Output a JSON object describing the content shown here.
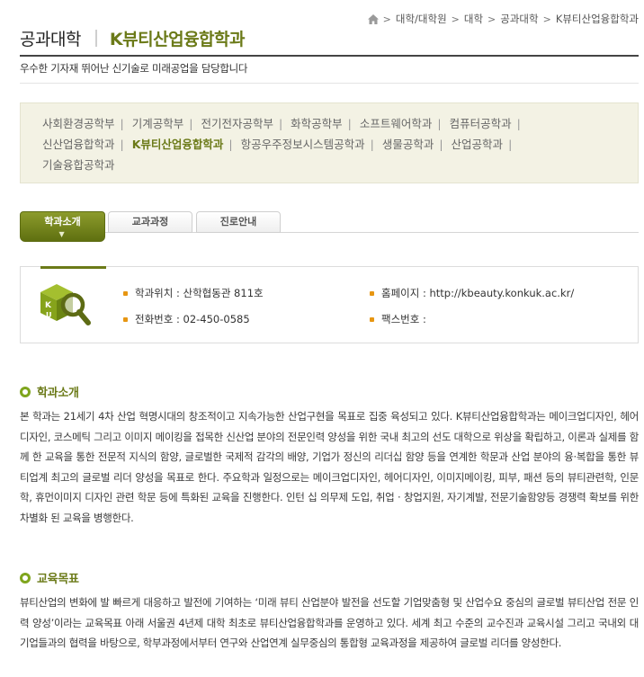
{
  "breadcrumb": {
    "items": [
      "대학/대학원",
      "대학",
      "공과대학",
      "K뷰티산업융합학과"
    ]
  },
  "header": {
    "college": "공과대학",
    "department": "K뷰티산업융합학과",
    "slogan": "우수한 기자재 뛰어난 신기술로 미래공업을 담당합니다"
  },
  "departments": [
    "사회환경공학부",
    "기계공학부",
    "전기전자공학부",
    "화학공학부",
    "소프트웨어학과",
    "컴퓨터공학과",
    "신산업융합학과",
    "K뷰티산업융합학과",
    "항공우주정보시스템공학과",
    "생물공학과",
    "산업공학과",
    "기술융합공학과"
  ],
  "tabs": [
    "학과소개",
    "교과과정",
    "진로안내"
  ],
  "info": {
    "location_label": "학과위치 : 산학협동관 811호",
    "homepage_label": "홈페이지 : http://kbeauty.konkuk.ac.kr/",
    "phone_label": "전화번호 : 02-450-0585",
    "fax_label": "팩스번호 :"
  },
  "sections": {
    "intro_title": "학과소개",
    "intro_text": "본 학과는 21세기 4차 산업 혁명시대의 창조적이고 지속가능한 산업구현을 목표로 집중 육성되고 있다. K뷰티산업융합학과는 메이크업디자인, 헤어디자인, 코스메틱 그리고 이미지 메이킹을 접목한 신산업 분야의 전문인력 양성을 위한 국내 최고의 선도 대학으로 위상을 확립하고, 이론과 실제를 함께 한 교육을 통한 전문적 지식의 함양, 글로벌한 국제적 감각의 배양, 기업가 정신의 리더십 함양 등을 연계한 학문과 산업 분야의 융·복합을 통한 뷰티업계 최고의 글로벌 리더 양성을 목표로 한다. 주요학과 일정으로는 메이크업디자인, 헤어디자인, 이미지메이킹, 피부, 패션 등의 뷰티관련학, 인문학, 휴먼이미지 디자인 관련 학문 등에 특화된 교육을 진행한다. 인턴 십 의무제 도입, 취업 · 창업지원, 자기계발, 전문기술함양등 경쟁력 확보를 위한 차별화 된 교육을 병행한다.",
    "goal_title": "교육목표",
    "goal_text": "뷰티산업의 변화에 발 빠르게 대응하고 발전에 기여하는 ‘미래 뷰티 산업분야 발전을 선도할 기업맞춤형 및 산업수요 중심의 글로벌 뷰티산업 전문 인력 양성’이라는 교육목표 아래 서울권 4년제 대학 최초로 뷰티산업융합학과를 운영하고 있다. 세계 최고 수준의 교수진과 교육시설 그리고 국내외 대기업들과의 협력을 바탕으로, 학부과정에서부터 연구와 산업연계 실무중심의 통합형 교육과정을 제공하여 글로벌 리더를 양성한다."
  },
  "colors": {
    "accent": "#6b7a18",
    "bullet": "#e79612",
    "ring": "#7fa51d",
    "dept_box_bg": "#f3f2e4"
  },
  "icons": [
    "home-icon",
    "chevron-down-icon",
    "department-logo-magnifier-icon",
    "bullet-icon",
    "section-ring-icon"
  ]
}
